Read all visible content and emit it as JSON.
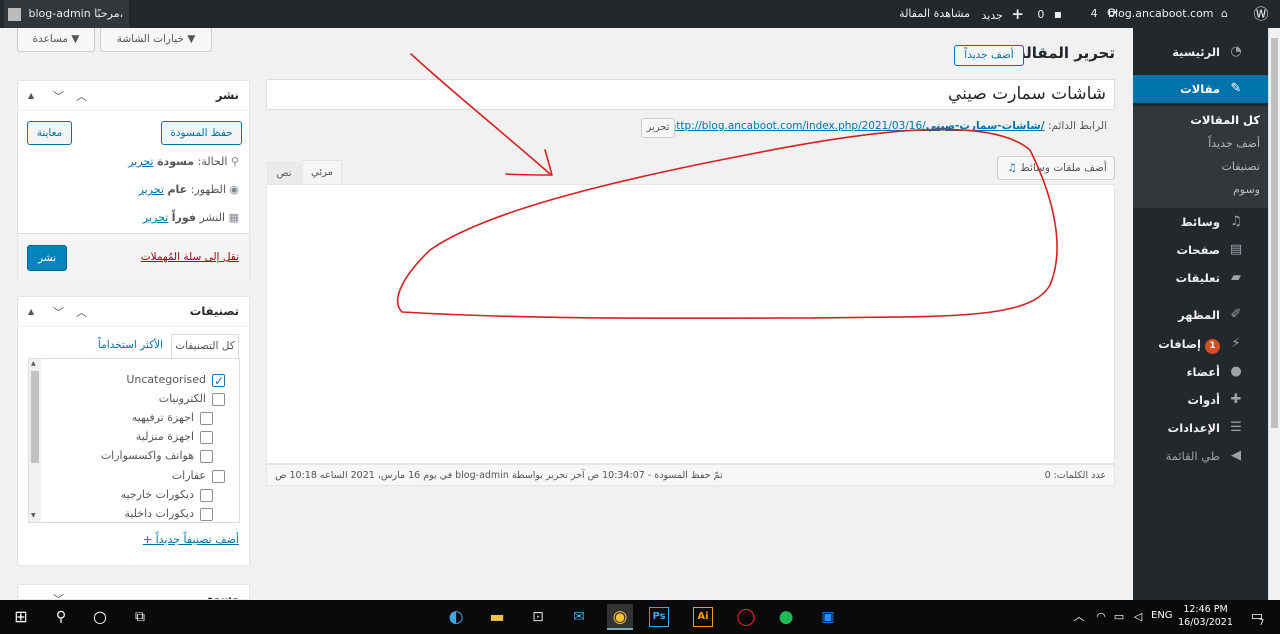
{
  "admin_bar": {
    "site_name": "blog.ancaboot.com",
    "updates_count": "4",
    "comments_count": "0",
    "new_label": "جديد",
    "view_post": "مشاهدة المقالة",
    "greeting": "مرحبًا،",
    "username": "blog-admin"
  },
  "sidebar": {
    "dashboard": "الرئيسية",
    "posts": "مقالات",
    "posts_sub": [
      "كل المقالات",
      "أضف جديداً",
      "تصنيفات",
      "وسوم"
    ],
    "media": "وسائط",
    "pages": "صفحات",
    "comments": "تعليقات",
    "appearance": "المظهر",
    "plugins": "إضافات",
    "plugins_badge": "1",
    "users": "أعضاء",
    "tools": "أدوات",
    "settings": "الإعدادات",
    "collapse": "طي القائمة"
  },
  "header": {
    "screen_options": "خيارات الشاشة",
    "help": "مساعدة",
    "page_title": "تحرير المقالة",
    "add_new": "أضف جديداً"
  },
  "editor": {
    "post_title": "شاشات سمارت صيني",
    "permalink_label": "الرابط الدائم:",
    "permalink_base": "http://blog.ancaboot.com/index.php/2021/03/16/",
    "permalink_slug": "شاشات-سمارت-صيني/",
    "edit_slug": "تحرير",
    "add_media": "أضف ملفات وسائط",
    "tab_visual": "مرئي",
    "tab_text": "نص",
    "word_count": "عدد الكلمات: 0",
    "status_line": "تمّ حفظ المسودة - 10:34:07 ص آخر تحرير بواسطة blog-admin في يوم 16 مارس، 2021 الساعه 10:18 ص"
  },
  "publish_box": {
    "title": "نشر",
    "save_draft": "حفظ المسودة",
    "preview": "معاينة",
    "status_label": "الحالة:",
    "status_value": "مسودة",
    "visibility_label": "الظهور:",
    "visibility_value": "عام",
    "schedule_label": "النشر",
    "schedule_value": "فوراً",
    "edit_link": "تحرير",
    "trash": "نقل إلى سلة المُهملات",
    "publish": "نشر"
  },
  "categories_box": {
    "title": "تصنيفات",
    "tab_all": "كل التصنيفات",
    "tab_popular": "الأكثر استخداماً",
    "items": [
      {
        "label": "Uncategorised",
        "checked": true
      },
      {
        "label": "الكترونيات",
        "checked": false
      },
      {
        "label": "اجهزة ترفيهيه",
        "checked": false
      },
      {
        "label": "اجهزة منزلية",
        "checked": false
      },
      {
        "label": "هواتف واكسسوارات",
        "checked": false
      },
      {
        "label": "عقارات",
        "checked": false
      },
      {
        "label": "ديكورات خارجيه",
        "checked": false
      },
      {
        "label": "ديكورات داخلية",
        "checked": false
      }
    ],
    "add_new": "+ أضف تصنيفاً جديداً"
  },
  "tags_box": {
    "title": "وسوم"
  },
  "taskbar": {
    "language": "ENG",
    "time": "12:46 PM",
    "date": "16/03/2021",
    "notifications": "7"
  },
  "colors": {
    "admin_dark": "#23282d",
    "accent": "#0073aa",
    "annotation": "#d62020"
  }
}
